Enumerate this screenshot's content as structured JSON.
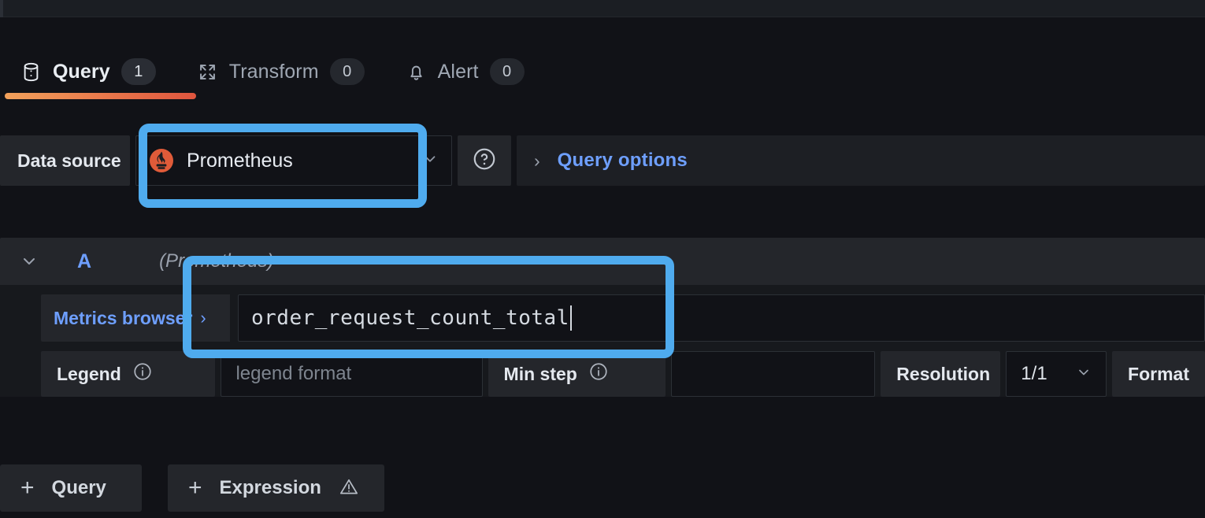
{
  "tabs": [
    {
      "label": "Query",
      "count": "1",
      "icon": "database-icon",
      "active": true
    },
    {
      "label": "Transform",
      "count": "0",
      "icon": "transform-icon",
      "active": false
    },
    {
      "label": "Alert",
      "count": "0",
      "icon": "bell-icon",
      "active": false
    }
  ],
  "datasource_row": {
    "label": "Data source",
    "selected": "Prometheus",
    "logo": "prometheus-logo",
    "help_icon": "question-circle-icon",
    "query_options_label": "Query options",
    "query_options_caret": "›"
  },
  "query": {
    "ref_id": "A",
    "datasource_note": "(Prometheus)",
    "collapse_icon": "chevron-down-icon",
    "metrics_browser_label": "Metrics browser",
    "metrics_browser_chevron": "›",
    "expression": "order_request_count_total",
    "options": {
      "legend_label": "Legend",
      "legend_placeholder": "legend format",
      "legend_value": "",
      "min_step_label": "Min step",
      "min_step_value": "",
      "resolution_label": "Resolution",
      "resolution_value": "1/1",
      "format_label": "Format",
      "info_icon": "info-circle-icon"
    }
  },
  "footer": {
    "add_query_label": "Query",
    "add_expression_label": "Expression",
    "plus_icon": "plus-icon",
    "warning_icon": "warning-triangle-icon"
  },
  "colors": {
    "accent_blue": "#6e9fff",
    "annotation_blue": "#4fabee",
    "tab_underline_from": "#f2a15b",
    "tab_underline_to": "#df553e",
    "prometheus_orange": "#e05b39",
    "panel_bg": "#24262b",
    "page_bg": "#111217"
  }
}
